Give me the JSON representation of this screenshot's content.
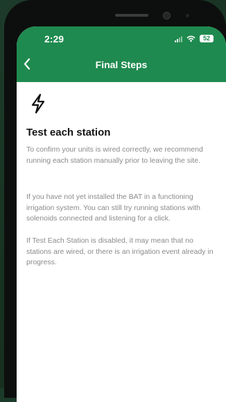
{
  "status_bar": {
    "time": "2:29",
    "battery": "52"
  },
  "header": {
    "title": "Final Steps"
  },
  "content": {
    "icon": "lightning-bolt-icon",
    "heading": "Test each station",
    "paragraphs": [
      "To confirm your units is wired correctly, we recommend running each station manually prior to leaving the site.",
      "If you have not yet installed the BAT in a functioning irrigation system. You can still try running stations with solenoids connected and listening for a click.",
      "If Test Each Station is disabled, it may mean that no stations are wired, or there is an irrigation event already in progress."
    ]
  },
  "colors": {
    "brand": "#1f8a4f",
    "backdrop": "#1c3a2a",
    "body_text": "#8a8a8a",
    "heading_text": "#151515"
  }
}
